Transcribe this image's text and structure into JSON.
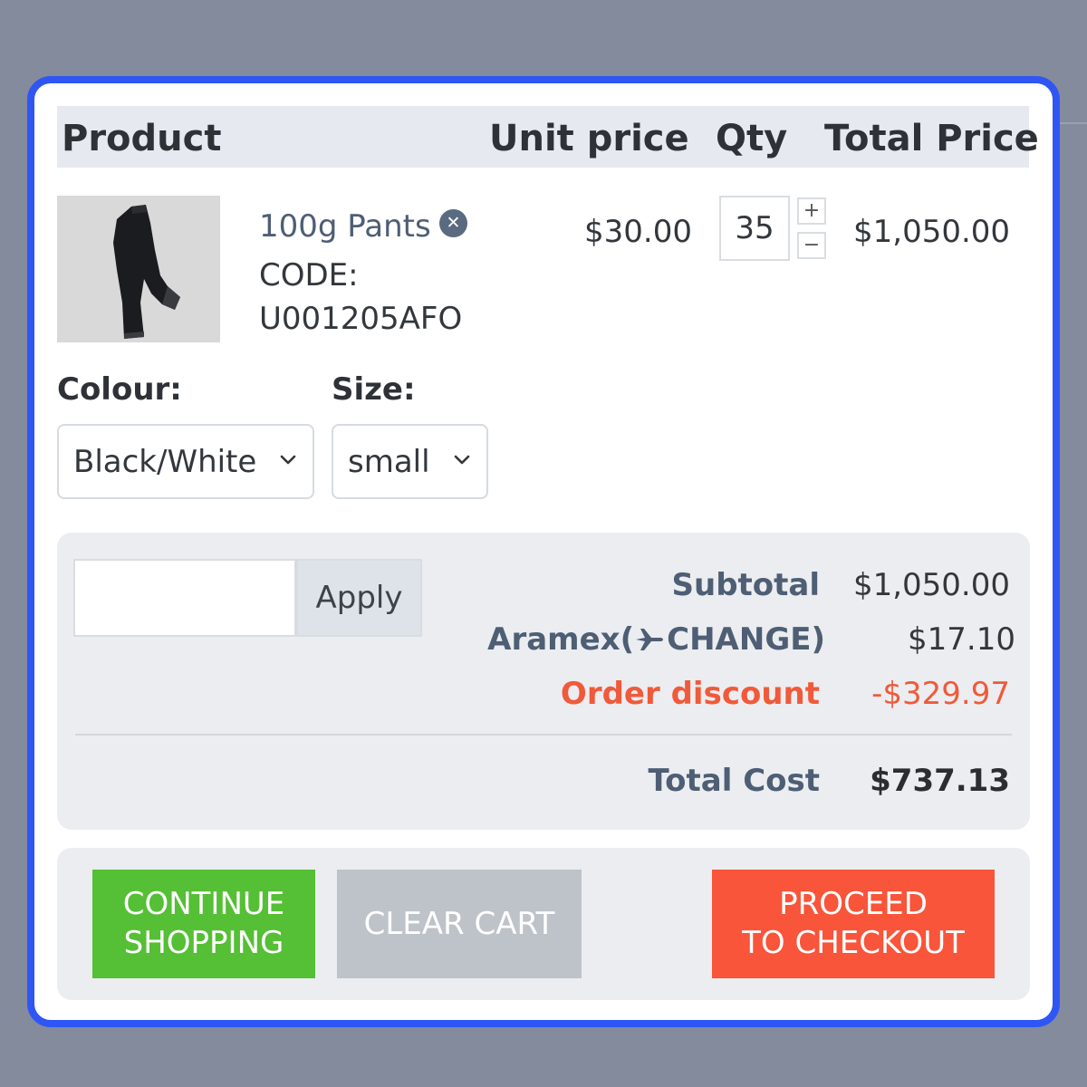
{
  "cart_table": {
    "headers": {
      "product": "Product",
      "unit_price": "Unit price",
      "qty": "Qty",
      "total_price": "Total Price"
    }
  },
  "item": {
    "name": "100g Pants",
    "code_label": "CODE:",
    "code_value": "U001205AFO",
    "unit_price": "$30.00",
    "qty": "35",
    "qty_increment": "+",
    "qty_decrement": "−",
    "total_price": "$1,050.00",
    "remove_icon": "close-circle-icon",
    "image": "black-pants-icon"
  },
  "options": {
    "colour_label": "Colour:",
    "colour_value": "Black/White",
    "size_label": "Size:",
    "size_value": "small"
  },
  "coupon": {
    "input_value": "",
    "apply_label": "Apply"
  },
  "summary": {
    "subtotal_label": "Subtotal",
    "subtotal_value": "$1,050.00",
    "shipping_label_prefix": "Aramex(",
    "shipping_icon": "airplane-icon",
    "shipping_change": "CHANGE)",
    "shipping_value": "$17.10",
    "discount_label": "Order discount",
    "discount_value": "-$329.97",
    "total_label": "Total Cost",
    "total_value": "$737.13"
  },
  "actions": {
    "continue_line1": "CONTINUE",
    "continue_line2": "SHOPPING",
    "clear_label": "CLEAR CART",
    "checkout_line1": "PROCEED",
    "checkout_line2": "TO CHECKOUT"
  },
  "colors": {
    "frame": "#2f56f5",
    "continue_button": "#55bf35",
    "clear_button": "#bec3c9",
    "checkout_button": "#f8553a",
    "discount_text": "#f05a3a",
    "muted_heading": "#4e5e74"
  }
}
